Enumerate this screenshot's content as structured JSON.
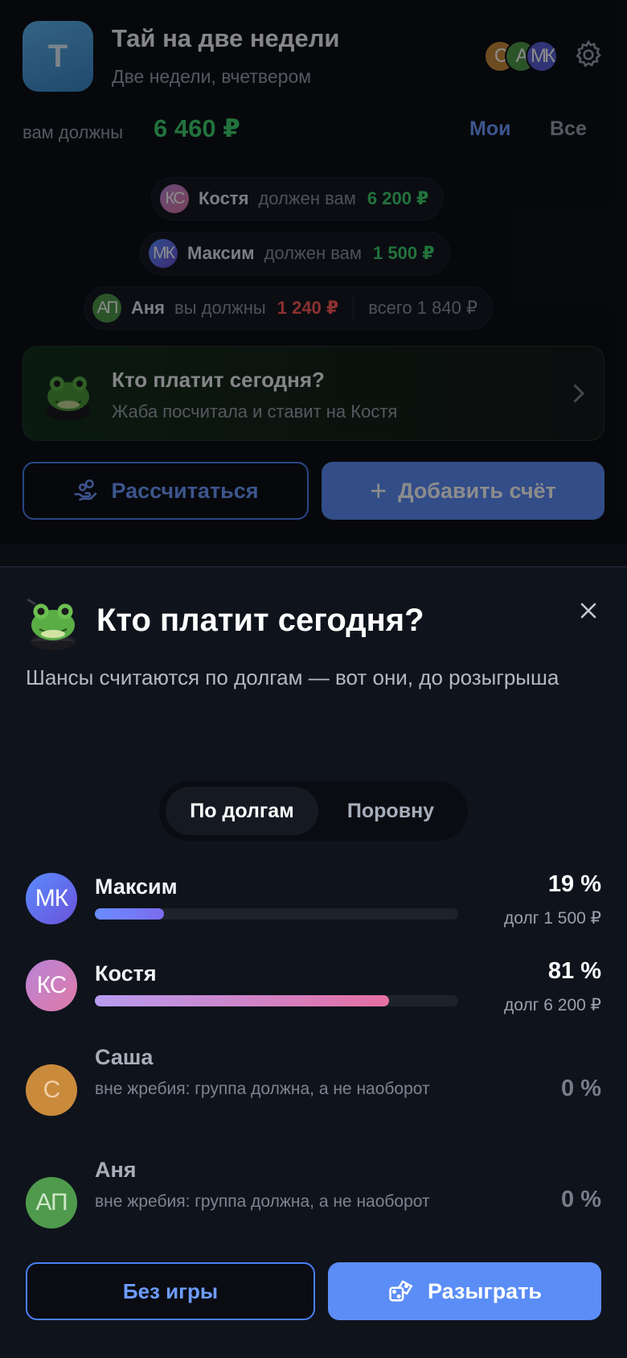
{
  "colors": {
    "accent": "#5b8df6",
    "positive": "#3ecf6e",
    "negative": "#ff5a5a",
    "card_green": "#13301e"
  },
  "group": {
    "avatar_letter": "Т",
    "title": "Тай на две недели",
    "subtitle": "Две недели, вчетвером",
    "member_initials": [
      "С",
      "А",
      "МК"
    ]
  },
  "summary": {
    "owed_label": "вам должны",
    "owed_amount": "6 460 ₽",
    "filter_mine": "Мои",
    "filter_all": "Все"
  },
  "balances": [
    {
      "initials": "КС",
      "name": "Костя",
      "text": "должен вам",
      "amount": "6 200 ₽",
      "direction": "positive"
    },
    {
      "initials": "МК",
      "name": "Максим",
      "text": "должен вам",
      "amount": "1 500 ₽",
      "direction": "positive"
    },
    {
      "initials": "АП",
      "name": "Аня",
      "text": "вы должны",
      "amount": "1 240 ₽",
      "direction": "negative",
      "total": "всего 1 840 ₽"
    }
  ],
  "who_pays_card": {
    "title": "Кто платит сегодня?",
    "subtitle": "Жаба посчитала и ставит на Костя"
  },
  "actions": {
    "settle": "Рассчитаться",
    "add_bill": "Добавить счёт"
  },
  "sheet": {
    "title": "Кто платит сегодня?",
    "description": "Шансы считаются по долгам — вот они, до розыгрыша",
    "segments": [
      "По долгам",
      "Поровну"
    ],
    "selected_segment": "По долгам",
    "participants": [
      {
        "initials": "МК",
        "name": "Максим",
        "percent_label": "19 %",
        "percent": 19,
        "debt": "долг 1 500 ₽"
      },
      {
        "initials": "КС",
        "name": "Костя",
        "percent_label": "81 %",
        "percent": 81,
        "debt": "долг 6 200 ₽"
      },
      {
        "initials": "С",
        "name": "Саша",
        "percent_label": "0 %",
        "note": "вне жребия: группа должна, а не наоборот"
      },
      {
        "initials": "АП",
        "name": "Аня",
        "percent_label": "0 %",
        "note": "вне жребия: группа должна, а не наоборот"
      }
    ],
    "no_game": "Без игры",
    "play": "Разыграть"
  }
}
